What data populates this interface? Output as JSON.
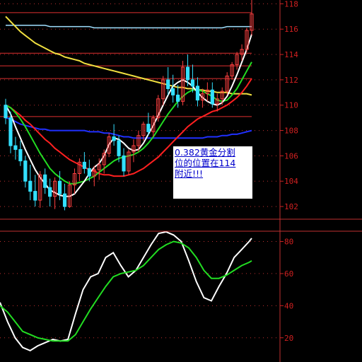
{
  "chart_data": [
    {
      "type": "candlestick",
      "ylim": [
        101,
        118.3
      ],
      "y_ticks": [
        "102",
        "104",
        "106",
        "108",
        "110",
        "112",
        "114",
        "116",
        "118"
      ],
      "y_tick_values": [
        102,
        104,
        106,
        108,
        110,
        112,
        114,
        116,
        118
      ],
      "horizontal_levels": [
        117.3,
        114.1,
        113.1,
        112.1,
        109.1
      ],
      "colors": {
        "up": "#ff4040",
        "down": "#33e0ff",
        "ma_white": "#ffffff",
        "ma_green": "#22dd22",
        "ma_red": "#ff2020",
        "ma_blue": "#2030ff",
        "ma_yellow": "#f0e040",
        "ma_cyan": "#a0e0ff",
        "grid": "#c03030",
        "axis_text": "#d02020"
      },
      "candles": [
        [
          110,
          110.5,
          108.5,
          109
        ],
        [
          109,
          109.5,
          106.2,
          106.8
        ],
        [
          106.8,
          107.5,
          105.7,
          106.5
        ],
        [
          106.5,
          107.2,
          105.2,
          105.6
        ],
        [
          105.6,
          106,
          103.5,
          104
        ],
        [
          104,
          105.3,
          102.5,
          103.2
        ],
        [
          103.2,
          104.5,
          102,
          102.5
        ],
        [
          102.5,
          104.8,
          101.9,
          104.5
        ],
        [
          104.5,
          105,
          103,
          103.5
        ],
        [
          103.5,
          104.2,
          102,
          102.8
        ],
        [
          102.8,
          104.3,
          101.8,
          104
        ],
        [
          104,
          104.8,
          102.5,
          103
        ],
        [
          103,
          103.8,
          101.7,
          102
        ],
        [
          102,
          104,
          101.9,
          103.7
        ],
        [
          103.7,
          105,
          103,
          104.6
        ],
        [
          104.6,
          105.8,
          104,
          105.5
        ],
        [
          105.5,
          106.3,
          104.6,
          105
        ],
        [
          105,
          105.7,
          104,
          104.4
        ],
        [
          104.4,
          105.2,
          103.6,
          104.9
        ],
        [
          104.9,
          105.8,
          104.1,
          105.3
        ],
        [
          105.3,
          106.5,
          104.6,
          106.2
        ],
        [
          106.2,
          107.8,
          105.9,
          107.5
        ],
        [
          107.5,
          108.5,
          106.8,
          107.2
        ],
        [
          107.2,
          107.6,
          105.5,
          106
        ],
        [
          106,
          106.6,
          104.4,
          104.8
        ],
        [
          104.8,
          106.5,
          104.5,
          106.3
        ],
        [
          106.3,
          107.3,
          105.5,
          106.8
        ],
        [
          106.8,
          108,
          106.3,
          107.6
        ],
        [
          107.6,
          108.7,
          107.2,
          108.5
        ],
        [
          108.5,
          109.4,
          107.6,
          107.9
        ],
        [
          107.9,
          109.2,
          107.5,
          109
        ],
        [
          109,
          110.8,
          108.7,
          110.5
        ],
        [
          110.5,
          112.3,
          110,
          112
        ],
        [
          112,
          113,
          110.8,
          111.3
        ],
        [
          111.3,
          112.4,
          110.2,
          110.8
        ],
        [
          110.8,
          111.6,
          109.8,
          110.3
        ],
        [
          110.3,
          113.5,
          110,
          113
        ],
        [
          113,
          114,
          111.5,
          112
        ],
        [
          112,
          113.2,
          111,
          111.5
        ],
        [
          111.5,
          112.2,
          109.9,
          110.4
        ],
        [
          110.4,
          111.3,
          109.8,
          110.9
        ],
        [
          110.9,
          111.8,
          110.3,
          111.2
        ],
        [
          111.2,
          111.8,
          109.8,
          110.1
        ],
        [
          110.1,
          110.9,
          109.5,
          110.5
        ],
        [
          110.5,
          111.4,
          110,
          111.1
        ],
        [
          111.1,
          112.6,
          110.8,
          112.3
        ],
        [
          112.3,
          113.4,
          112,
          113.2
        ],
        [
          113.2,
          114.2,
          112.8,
          114
        ],
        [
          114,
          114.8,
          113.5,
          114.4
        ],
        [
          114.4,
          116.1,
          114.2,
          115.9
        ],
        [
          115.9,
          118.3,
          115.5,
          117.2
        ]
      ],
      "ma_white": [
        110,
        109.3,
        108.3,
        107.4,
        106.5,
        105.7,
        104.9,
        104.3,
        103.8,
        103.3,
        103.1,
        102.9,
        102.8,
        102.8,
        103.0,
        103.5,
        104.0,
        104.6,
        105.1,
        105.4,
        106.0,
        106.9,
        107.4,
        107.3,
        107.0,
        106.6,
        106.4,
        106.5,
        107.0,
        107.7,
        108.4,
        109.2,
        110.0,
        110.8,
        111.5,
        111.8,
        112.0,
        111.8,
        111.5,
        111.0,
        110.6,
        110.3,
        110.1,
        110.0,
        110.2,
        110.7,
        111.5,
        112.4,
        113.4,
        114.4,
        115.6
      ],
      "ma_green": [
        110,
        109.8,
        109.4,
        108.9,
        108.3,
        107.6,
        106.9,
        106.2,
        105.6,
        105.0,
        104.6,
        104.3,
        104.0,
        103.8,
        103.8,
        103.9,
        104.0,
        104.2,
        104.4,
        104.7,
        105.0,
        105.3,
        105.6,
        105.8,
        105.9,
        106.0,
        106.1,
        106.3,
        106.6,
        107.0,
        107.5,
        108.1,
        108.7,
        109.3,
        109.8,
        110.3,
        110.7,
        111.0,
        111.2,
        111.2,
        111.1,
        110.9,
        110.7,
        110.4,
        110.3,
        110.4,
        110.8,
        111.3,
        112.0,
        112.7,
        113.4
      ],
      "ma_red": [
        110,
        109.8,
        109.5,
        109.2,
        108.8,
        108.5,
        108.1,
        107.7,
        107.3,
        107.0,
        106.6,
        106.3,
        106.0,
        105.7,
        105.5,
        105.3,
        105.1,
        104.9,
        104.8,
        104.6,
        104.5,
        104.5,
        104.4,
        104.4,
        104.4,
        104.5,
        104.6,
        104.8,
        105.0,
        105.3,
        105.6,
        105.9,
        106.3,
        106.7,
        107.1,
        107.5,
        107.9,
        108.3,
        108.6,
        108.9,
        109.1,
        109.3,
        109.5,
        109.6,
        109.8,
        110.0,
        110.3,
        110.6,
        111.0,
        111.5,
        112.1
      ],
      "ma_blue": [
        109,
        108.9,
        108.7,
        108.5,
        108.4,
        108.3,
        108.2,
        108.1,
        108.1,
        108.0,
        108.0,
        108.0,
        108.0,
        108.0,
        108.0,
        108.0,
        108.0,
        107.9,
        107.9,
        107.9,
        107.8,
        107.8,
        107.7,
        107.6,
        107.5,
        107.5,
        107.4,
        107.4,
        107.4,
        107.4,
        107.4,
        107.4,
        107.4,
        107.4,
        107.4,
        107.4,
        107.4,
        107.4,
        107.4,
        107.4,
        107.4,
        107.5,
        107.5,
        107.5,
        107.6,
        107.6,
        107.7,
        107.7,
        107.8,
        107.9,
        108.0
      ],
      "ma_yellow": [
        117.0,
        116.6,
        116.2,
        115.8,
        115.5,
        115.2,
        114.9,
        114.7,
        114.5,
        114.3,
        114.1,
        114.0,
        113.8,
        113.7,
        113.6,
        113.5,
        113.3,
        113.2,
        113.1,
        113.0,
        112.9,
        112.8,
        112.7,
        112.6,
        112.5,
        112.4,
        112.3,
        112.2,
        112.1,
        112.0,
        111.9,
        111.8,
        111.7,
        111.6,
        111.5,
        111.4,
        111.4,
        111.3,
        111.3,
        111.2,
        111.2,
        111.1,
        111.1,
        111.0,
        111.0,
        111.0,
        110.9,
        110.9,
        110.9,
        110.9,
        110.8
      ],
      "ma_cyan": [
        116.3,
        116.3,
        116.3,
        116.3,
        116.3,
        116.3,
        116.3,
        116.3,
        116.3,
        116.2,
        116.2,
        116.2,
        116.2,
        116.2,
        116.2,
        116.2,
        116.2,
        116.2,
        116.1,
        116.1,
        116.1,
        116.1,
        116.1,
        116.1,
        116.1,
        116.1,
        116.1,
        116.1,
        116.1,
        116.1,
        116.1,
        116.1,
        116.1,
        116.1,
        116.1,
        116.1,
        116.1,
        116.1,
        116.1,
        116.1,
        116.1,
        116.1,
        116.1,
        116.1,
        116.1,
        116.2,
        116.2,
        116.2,
        116.2,
        116.2,
        116.2
      ],
      "annotation": {
        "lines": [
          "0.382黄金分割",
          "位的位置在114",
          "附近!!!"
        ]
      }
    },
    {
      "type": "line",
      "ylim": [
        8,
        93
      ],
      "y_ticks": [
        "20",
        "40",
        "60",
        "80"
      ],
      "y_tick_values": [
        20,
        40,
        60,
        80
      ],
      "x": [
        0,
        0.03,
        0.06,
        0.09,
        0.12,
        0.15,
        0.18,
        0.21,
        0.24,
        0.27,
        0.3,
        0.33,
        0.36,
        0.39,
        0.42,
        0.45,
        0.48,
        0.51,
        0.54,
        0.57,
        0.6,
        0.63,
        0.66,
        0.69,
        0.72,
        0.75,
        0.78,
        0.81,
        0.84,
        0.87,
        0.9,
        0.93,
        0.96,
        0.99,
        1.0
      ],
      "series": [
        {
          "color": "#ffffff",
          "values": [
            42,
            30,
            20,
            14,
            12,
            15,
            17,
            19,
            18,
            19,
            35,
            50,
            58,
            60,
            70,
            73,
            65,
            58,
            62,
            70,
            78,
            85,
            86,
            84,
            80,
            68,
            55,
            45,
            43,
            52,
            60,
            70,
            75,
            80,
            82
          ]
        },
        {
          "color": "#22dd22",
          "values": [
            40,
            36,
            30,
            24,
            22,
            20,
            19,
            18,
            18,
            18,
            22,
            30,
            38,
            45,
            52,
            58,
            60,
            61,
            62,
            65,
            70,
            75,
            78,
            80,
            79,
            76,
            70,
            62,
            57,
            57,
            59,
            62,
            65,
            67,
            68
          ]
        }
      ]
    }
  ]
}
